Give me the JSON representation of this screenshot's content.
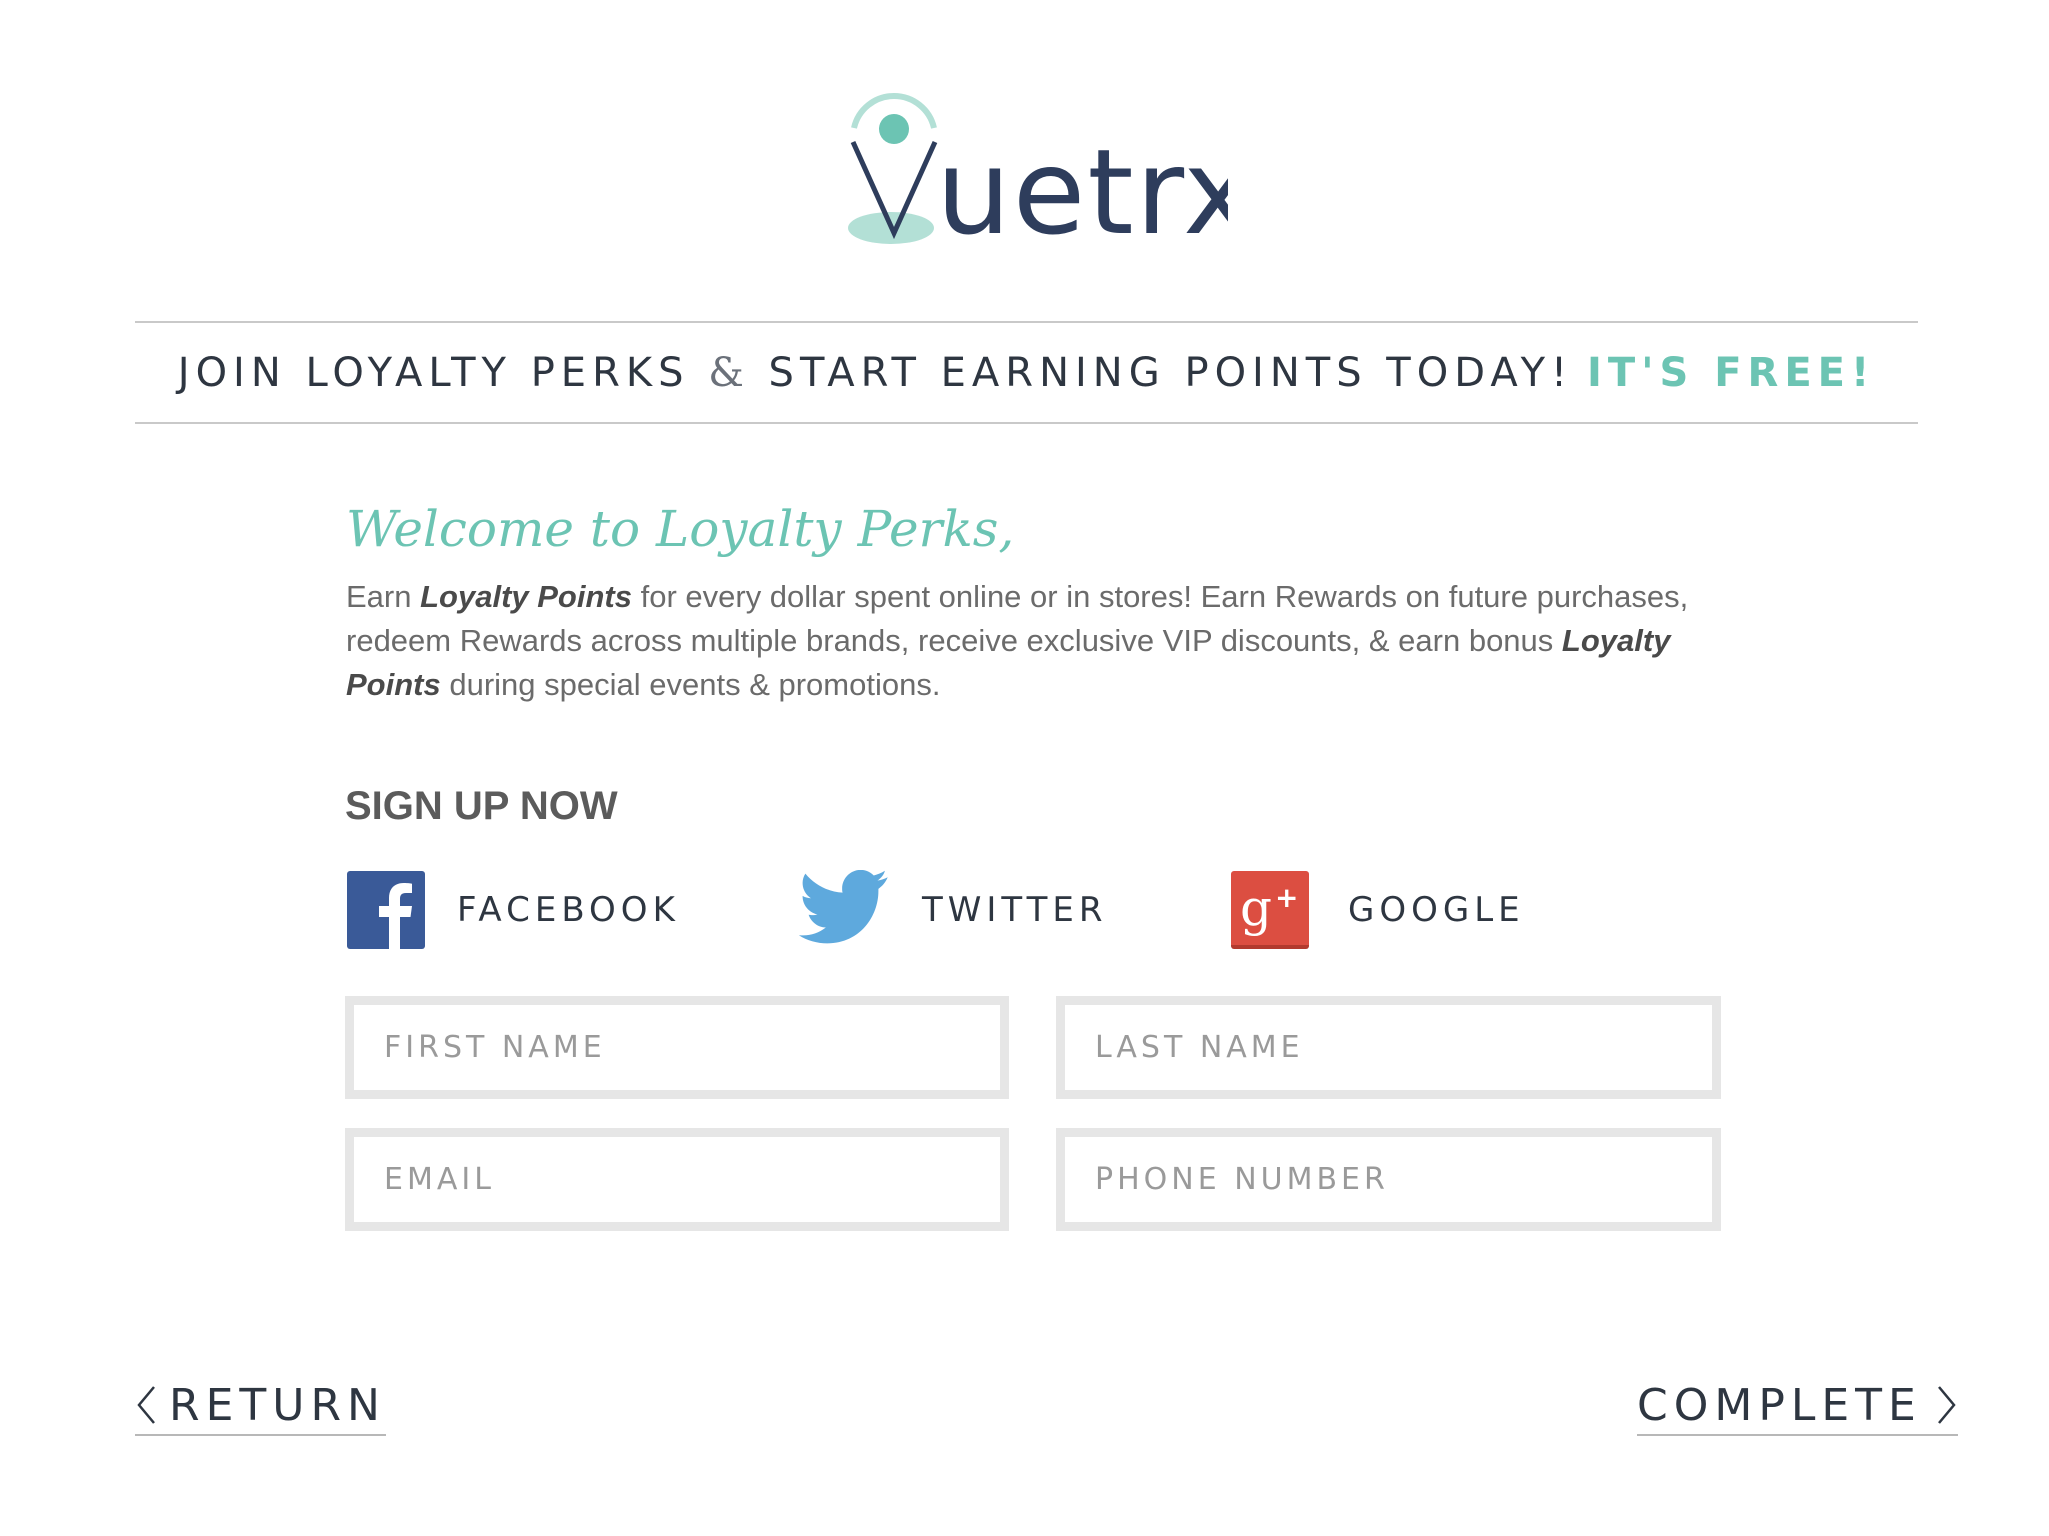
{
  "brand": {
    "name": "Vuetrx",
    "primary_color": "#2e3d5c",
    "accent_color": "#6cc4b3"
  },
  "banner": {
    "text_part1": "JOIN LOYALTY PERKS",
    "ampersand": "&",
    "text_part2": "START EARNING POINTS TODAY!",
    "highlight": "IT'S FREE!"
  },
  "welcome": {
    "title": "Welcome to Loyalty Perks,",
    "body_1": "Earn ",
    "emph_1": "Loyalty Points",
    "body_2": " for every dollar spent online or in stores! Earn Rewards on future purchases, redeem Rewards across multiple brands, receive exclusive VIP discounts, & earn bonus ",
    "emph_2": "Loyalty Points",
    "body_3": " during special events & promotions."
  },
  "signup": {
    "heading": "SIGN UP NOW",
    "social": [
      {
        "label": "FACEBOOK",
        "icon": "facebook-icon",
        "color": "#3a5a98"
      },
      {
        "label": "TWITTER",
        "icon": "twitter-icon",
        "color": "#5ea9dd"
      },
      {
        "label": "GOOGLE",
        "icon": "google-plus-icon",
        "color": "#dc4e41"
      }
    ],
    "fields": {
      "first_name": {
        "placeholder": "FIRST NAME",
        "value": ""
      },
      "last_name": {
        "placeholder": "LAST NAME",
        "value": ""
      },
      "email": {
        "placeholder": "EMAIL",
        "value": ""
      },
      "phone": {
        "placeholder": "PHONE NUMBER",
        "value": ""
      }
    }
  },
  "footer": {
    "return_label": "RETURN",
    "complete_label": "COMPLETE"
  }
}
